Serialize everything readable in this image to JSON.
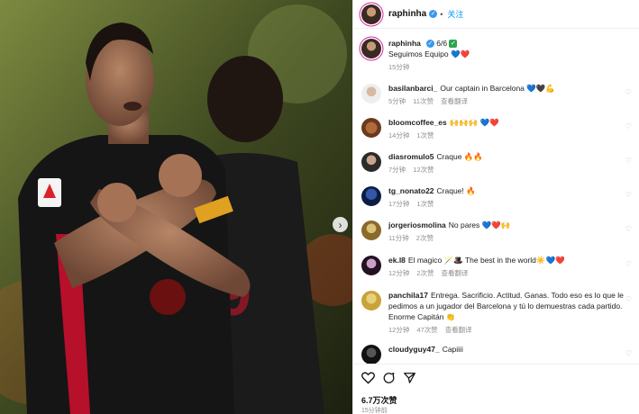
{
  "header": {
    "username": "raphinha",
    "follow_label": "关注",
    "separator": "•"
  },
  "photo": {
    "kit_number": "9",
    "next_icon": "chevron-right-icon"
  },
  "caption": {
    "username": "raphinha",
    "date": "6/6",
    "text": "Seguimos Equipo 💙❤️",
    "time": "15分钟"
  },
  "comments": [
    {
      "username": "basilanbarci_",
      "text": "Our captain in Barcelona 💙🖤💪",
      "time": "5分钟",
      "likes": "11次赞",
      "translate": "查看翻译"
    },
    {
      "username": "bloomcoffee_es",
      "text": "🙌🙌🙌 💙❤️",
      "time": "14分钟",
      "likes": "1次赞",
      "translate": ""
    },
    {
      "username": "diasromulo5",
      "text": "Craque 🔥🔥",
      "time": "7分钟",
      "likes": "12次赞",
      "translate": ""
    },
    {
      "username": "tg_nonato22",
      "text": "Craque! 🔥",
      "time": "17分钟",
      "likes": "1次赞",
      "translate": ""
    },
    {
      "username": "jorgeriosmolina",
      "text": "No pares 💙❤️🙌",
      "time": "11分钟",
      "likes": "2次赞",
      "translate": ""
    },
    {
      "username": "ek.l8",
      "text": "El magico 🪄🎩 The best in the world☀️💙❤️",
      "time": "12分钟",
      "likes": "2次赞",
      "translate": "查看翻译"
    },
    {
      "username": "panchila17",
      "text": "Entrega. Sacrificio. Actitud. Ganas. Todo eso es lo que le pedimos a un jugador del Barcelona y tú lo demuestras cada partido. Enorme Capitán 👏",
      "time": "12分钟",
      "likes": "47次赞",
      "translate": "查看翻译"
    },
    {
      "username": "cloudyguy47_",
      "text": "Capiiii",
      "time": "",
      "likes": "",
      "translate": ""
    }
  ],
  "footer": {
    "likes_count": "6.7万次赞",
    "time_ago": "15分钟前",
    "icons": [
      "heart-icon",
      "comment-icon",
      "share-icon"
    ]
  },
  "colors": {
    "link_blue": "#0095f6",
    "verified_blue": "#3897f0",
    "jersey_black": "#151515",
    "jersey_red": "#c8102e"
  }
}
